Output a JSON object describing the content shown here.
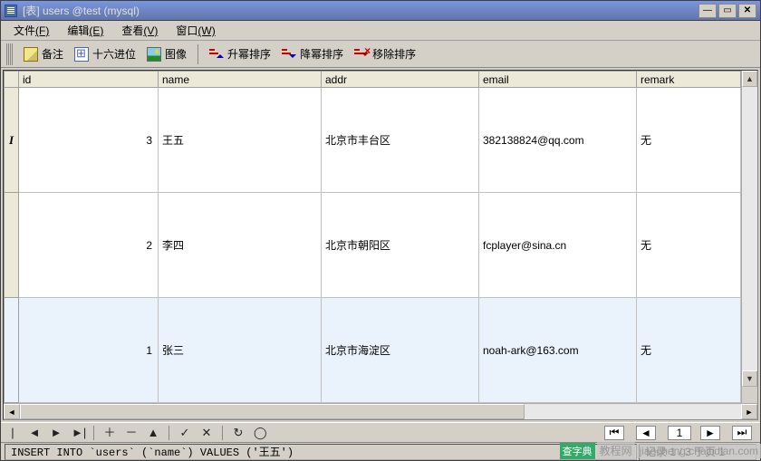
{
  "window": {
    "title": "[表] users @test (mysql)"
  },
  "menu": {
    "file": "文件",
    "file_k": "(F)",
    "edit": "编辑",
    "edit_k": "(E)",
    "view": "查看",
    "view_k": "(V)",
    "window": "窗口",
    "window_k": "(W)"
  },
  "toolbar": {
    "memo": "备注",
    "hex": "十六进位",
    "image": "图像",
    "sort_asc": "升幂排序",
    "sort_desc": "降幂排序",
    "sort_remove": "移除排序"
  },
  "columns": {
    "id": "id",
    "name": "name",
    "addr": "addr",
    "email": "email",
    "remark": "remark"
  },
  "rows": [
    {
      "id": "3",
      "name": "王五",
      "addr": "北京市丰台区",
      "email": "382138824@qq.com",
      "remark": "无"
    },
    {
      "id": "2",
      "name": "李四",
      "addr": "北京市朝阳区",
      "email": "fcplayer@sina.cn",
      "remark": "无"
    },
    {
      "id": "1",
      "name": "张三",
      "addr": "北京市海淀区",
      "email": "noah-ark@163.com",
      "remark": "无"
    }
  ],
  "nav": {
    "page_input": "1"
  },
  "status": {
    "sql": "INSERT INTO `users` (`name`) VALUES ('王五')",
    "record": "记录 1 / 3 于页 1"
  },
  "watermark": {
    "logo": "查字典",
    "text": "教程网",
    "url": "jiaocheng.chazidian.com"
  }
}
